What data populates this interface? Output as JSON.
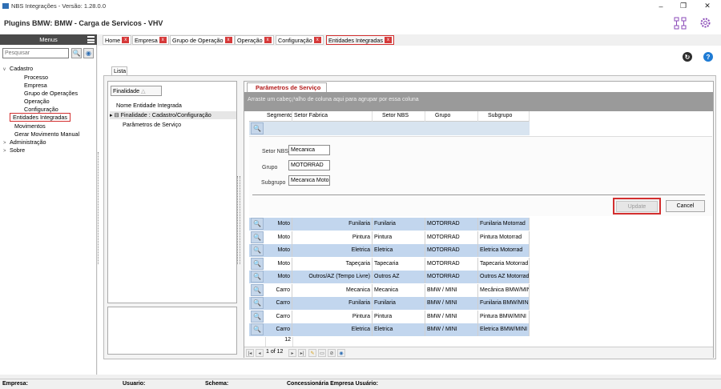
{
  "window": {
    "title": "NBS Integrações - Versão: 1.28.0.0",
    "minimize": "–",
    "restore": "❐",
    "close": "✕"
  },
  "header": {
    "title": "Plugins BMW: BMW - Carga de Servicos - VHV"
  },
  "sidebar": {
    "menus_label": "Menus",
    "search_placeholder": "Pesquisar",
    "tree": [
      {
        "label": "Cadastro",
        "arrow": "v"
      },
      {
        "label": "Processo"
      },
      {
        "label": "Empresa"
      },
      {
        "label": "Grupo de Operações"
      },
      {
        "label": "Operação"
      },
      {
        "label": "Configuração"
      },
      {
        "label": "Entidades Integradas"
      },
      {
        "label": "Movimentos"
      },
      {
        "label": "Gerar Movimento Manual"
      },
      {
        "label": "Administração",
        "arrow": ">"
      },
      {
        "label": "Sobre",
        "arrow": ">"
      }
    ]
  },
  "tabs": [
    {
      "label": "Home"
    },
    {
      "label": "Empresa"
    },
    {
      "label": "Grupo de Operação"
    },
    {
      "label": "Operação"
    },
    {
      "label": "Configuração"
    },
    {
      "label": "Entidades Integradas"
    }
  ],
  "tab_close": "x",
  "colors": {
    "accent": "#2f6fb4",
    "highlight": "#d32f2f",
    "row_alt": "#c2d6ee",
    "title_red": "#b31919"
  },
  "content": {
    "lista_tab": "Lista",
    "left": {
      "group_box": "Finalidade",
      "group_box_sort": "△",
      "header": "Nome Entidade Integrada",
      "row1": "Finalidade : Cadastro/Configuração",
      "row2": "Parâmetros de Serviço"
    },
    "right": {
      "tab": "Parâmetros de Serviço",
      "groupby_hint": "Arraste um cabeç¡¹alho de coluna aqui para agrupar por essa coluna",
      "columns": [
        "Segmento",
        "Setor Fabrica",
        "Setor NBS",
        "Grupo",
        "Subgrupo"
      ],
      "form": {
        "setor_label": "Setor NBS",
        "setor_value": "Mecanica",
        "grupo_label": "Grupo",
        "grupo_value": "MOTORRAD",
        "subgrupo_label": "Subgrupo",
        "subgrupo_value": "Mecanica Motorrad"
      },
      "update": "Update",
      "cancel": "Cancel",
      "rows": [
        {
          "seg": "Moto",
          "fab": "Funilaria",
          "nbs": "Funilaria",
          "grupo": "MOTORRAD",
          "sub": "Funilaria Motorrad"
        },
        {
          "seg": "Moto",
          "fab": "Pintura",
          "nbs": "Pintura",
          "grupo": "MOTORRAD",
          "sub": "Pintura Motorrad"
        },
        {
          "seg": "Moto",
          "fab": "Eletrica",
          "nbs": "Eletrica",
          "grupo": "MOTORRAD",
          "sub": "Eletrica Motorrad"
        },
        {
          "seg": "Moto",
          "fab": "Tapeçaria",
          "nbs": "Tapecaria",
          "grupo": "MOTORRAD",
          "sub": "Tapecaria Motorrad"
        },
        {
          "seg": "Moto",
          "fab": "Outros/AZ (Tempo Livre)",
          "nbs": "Outros AZ",
          "grupo": "MOTORRAD",
          "sub": "Outros AZ Motorrad"
        },
        {
          "seg": "Carro",
          "fab": "Mecanica",
          "nbs": "Mecanica",
          "grupo": "BMW / MINI",
          "sub": "Mecânica BMW/MINI"
        },
        {
          "seg": "Carro",
          "fab": "Funilaria",
          "nbs": "Funilaria",
          "grupo": "BMW / MINI",
          "sub": "Funilaria BMW/MINI"
        },
        {
          "seg": "Carro",
          "fab": "Pintura",
          "nbs": "Pintura",
          "grupo": "BMW / MINI",
          "sub": "Pintura BMW/MINI"
        },
        {
          "seg": "Carro",
          "fab": "Eletrica",
          "nbs": "Eletrica",
          "grupo": "BMW / MINI",
          "sub": "Eletrica BMW/MINI"
        }
      ],
      "count": "12",
      "pager": "1 of 12"
    }
  },
  "status": {
    "empresa": "Empresa:",
    "usuario": "Usuario:",
    "schema": "Schema:",
    "conc": "Concessionária Empresa Usuário:"
  }
}
